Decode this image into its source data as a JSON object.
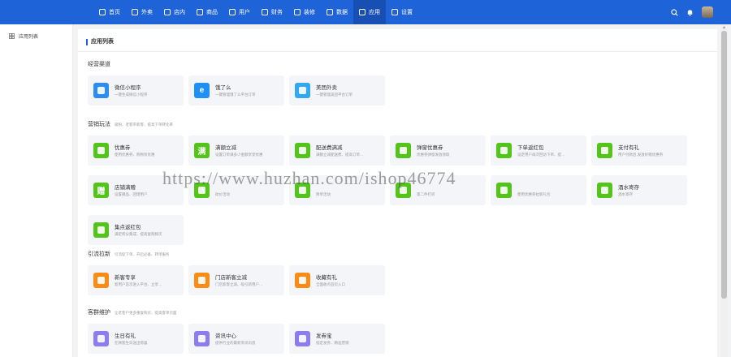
{
  "nav": {
    "items": [
      {
        "label": "首页",
        "icon": "home-icon"
      },
      {
        "label": "外卖",
        "icon": "bike-icon"
      },
      {
        "label": "店内",
        "icon": "store-icon"
      },
      {
        "label": "商品",
        "icon": "goods-icon"
      },
      {
        "label": "用户",
        "icon": "user-icon"
      },
      {
        "label": "财务",
        "icon": "money-icon"
      },
      {
        "label": "装修",
        "icon": "decor-icon"
      },
      {
        "label": "数据",
        "icon": "chart-icon"
      },
      {
        "label": "应用",
        "icon": "apps-icon"
      },
      {
        "label": "设置",
        "icon": "gear-icon"
      }
    ],
    "active_index": 8
  },
  "sidebar": {
    "item_label": "应用列表"
  },
  "page": {
    "title": "应用列表"
  },
  "sections": [
    {
      "title": "经营渠道",
      "desc": "",
      "cards": [
        {
          "name": "微信小程序",
          "desc": "一键生成微信小程序",
          "color": "#2d8cf0",
          "glyph": ""
        },
        {
          "name": "饿了么",
          "desc": "一键管理饿了么平台订单",
          "color": "#1e8ff5",
          "glyph": "e"
        },
        {
          "name": "美团外卖",
          "desc": "一键管理美团平台订单",
          "color": "#32a8f0",
          "glyph": ""
        }
      ]
    },
    {
      "title": "营销玩法",
      "desc": "吸粉、老客带新客、提高下单转化率",
      "cards": [
        {
          "name": "优惠券",
          "desc": "使用优惠券、购物有优惠",
          "color": "#52c41a",
          "glyph": ""
        },
        {
          "name": "满额立减",
          "desc": "设置订单满多少金额享受优惠",
          "color": "#52c41a",
          "glyph": "满"
        },
        {
          "name": "配送费满减",
          "desc": "满额立减配送费、提高订单…",
          "color": "#52c41a",
          "glyph": ""
        },
        {
          "name": "弹窗优惠券",
          "desc": "优惠券弹窗发放领取",
          "color": "#52c41a",
          "glyph": ""
        },
        {
          "name": "下单返红包",
          "desc": "设定用户再次回访下单、提…",
          "color": "#52c41a",
          "glyph": ""
        },
        {
          "name": "支付有礼",
          "desc": "用户付款后,发放好赠优惠券",
          "color": "#52c41a",
          "glyph": ""
        },
        {
          "name": "店铺满赠",
          "desc": "设置赠品、回馈用户",
          "color": "#52c41a",
          "glyph": "赠"
        },
        {
          "name": "",
          "desc": "砍价活动",
          "color": "#52c41a",
          "glyph": ""
        },
        {
          "name": "",
          "desc": "简单活动",
          "color": "#52c41a",
          "glyph": ""
        },
        {
          "name": "",
          "desc": "第二件打折",
          "color": "#52c41a",
          "glyph": ""
        },
        {
          "name": "",
          "desc": "使用优惠券拉新礼包",
          "color": "#52c41a",
          "glyph": ""
        },
        {
          "name": "酒水寄存",
          "desc": "酒水寄存",
          "color": "#52c41a",
          "glyph": ""
        },
        {
          "name": "集点返红包",
          "desc": "满足积分集成、提高复购频次",
          "color": "#52c41a",
          "glyph": ""
        }
      ]
    },
    {
      "title": "引流拉新",
      "desc": "引流促下单、开启必备、转单服务",
      "cards": [
        {
          "name": "新客专享",
          "desc": "新用户首次进入平台、立享…",
          "color": "#fa8c16",
          "glyph": ""
        },
        {
          "name": "门店新客立减",
          "desc": "门店新客立减、吸引新用户…",
          "color": "#fa8c16",
          "glyph": ""
        },
        {
          "name": "收藏有礼",
          "desc": "全面收点首页入口",
          "color": "#fa8c16",
          "glyph": ""
        }
      ]
    },
    {
      "title": "客群维护",
      "desc": "让老客户更多重复购买、提高客单页面",
      "cards": [
        {
          "name": "生日有礼",
          "desc": "在顾客生日送出惊喜",
          "color": "#8c7cf0",
          "glyph": ""
        },
        {
          "name": "资讯中心",
          "desc": "提供行业的最新资讯讯息",
          "color": "#8c7cf0",
          "glyph": ""
        },
        {
          "name": "发券宝",
          "desc": "指定发券、精准营销",
          "color": "#8c7cf0",
          "glyph": ""
        }
      ]
    }
  ],
  "watermark": "https://www.huzhan.com/ishop46774"
}
